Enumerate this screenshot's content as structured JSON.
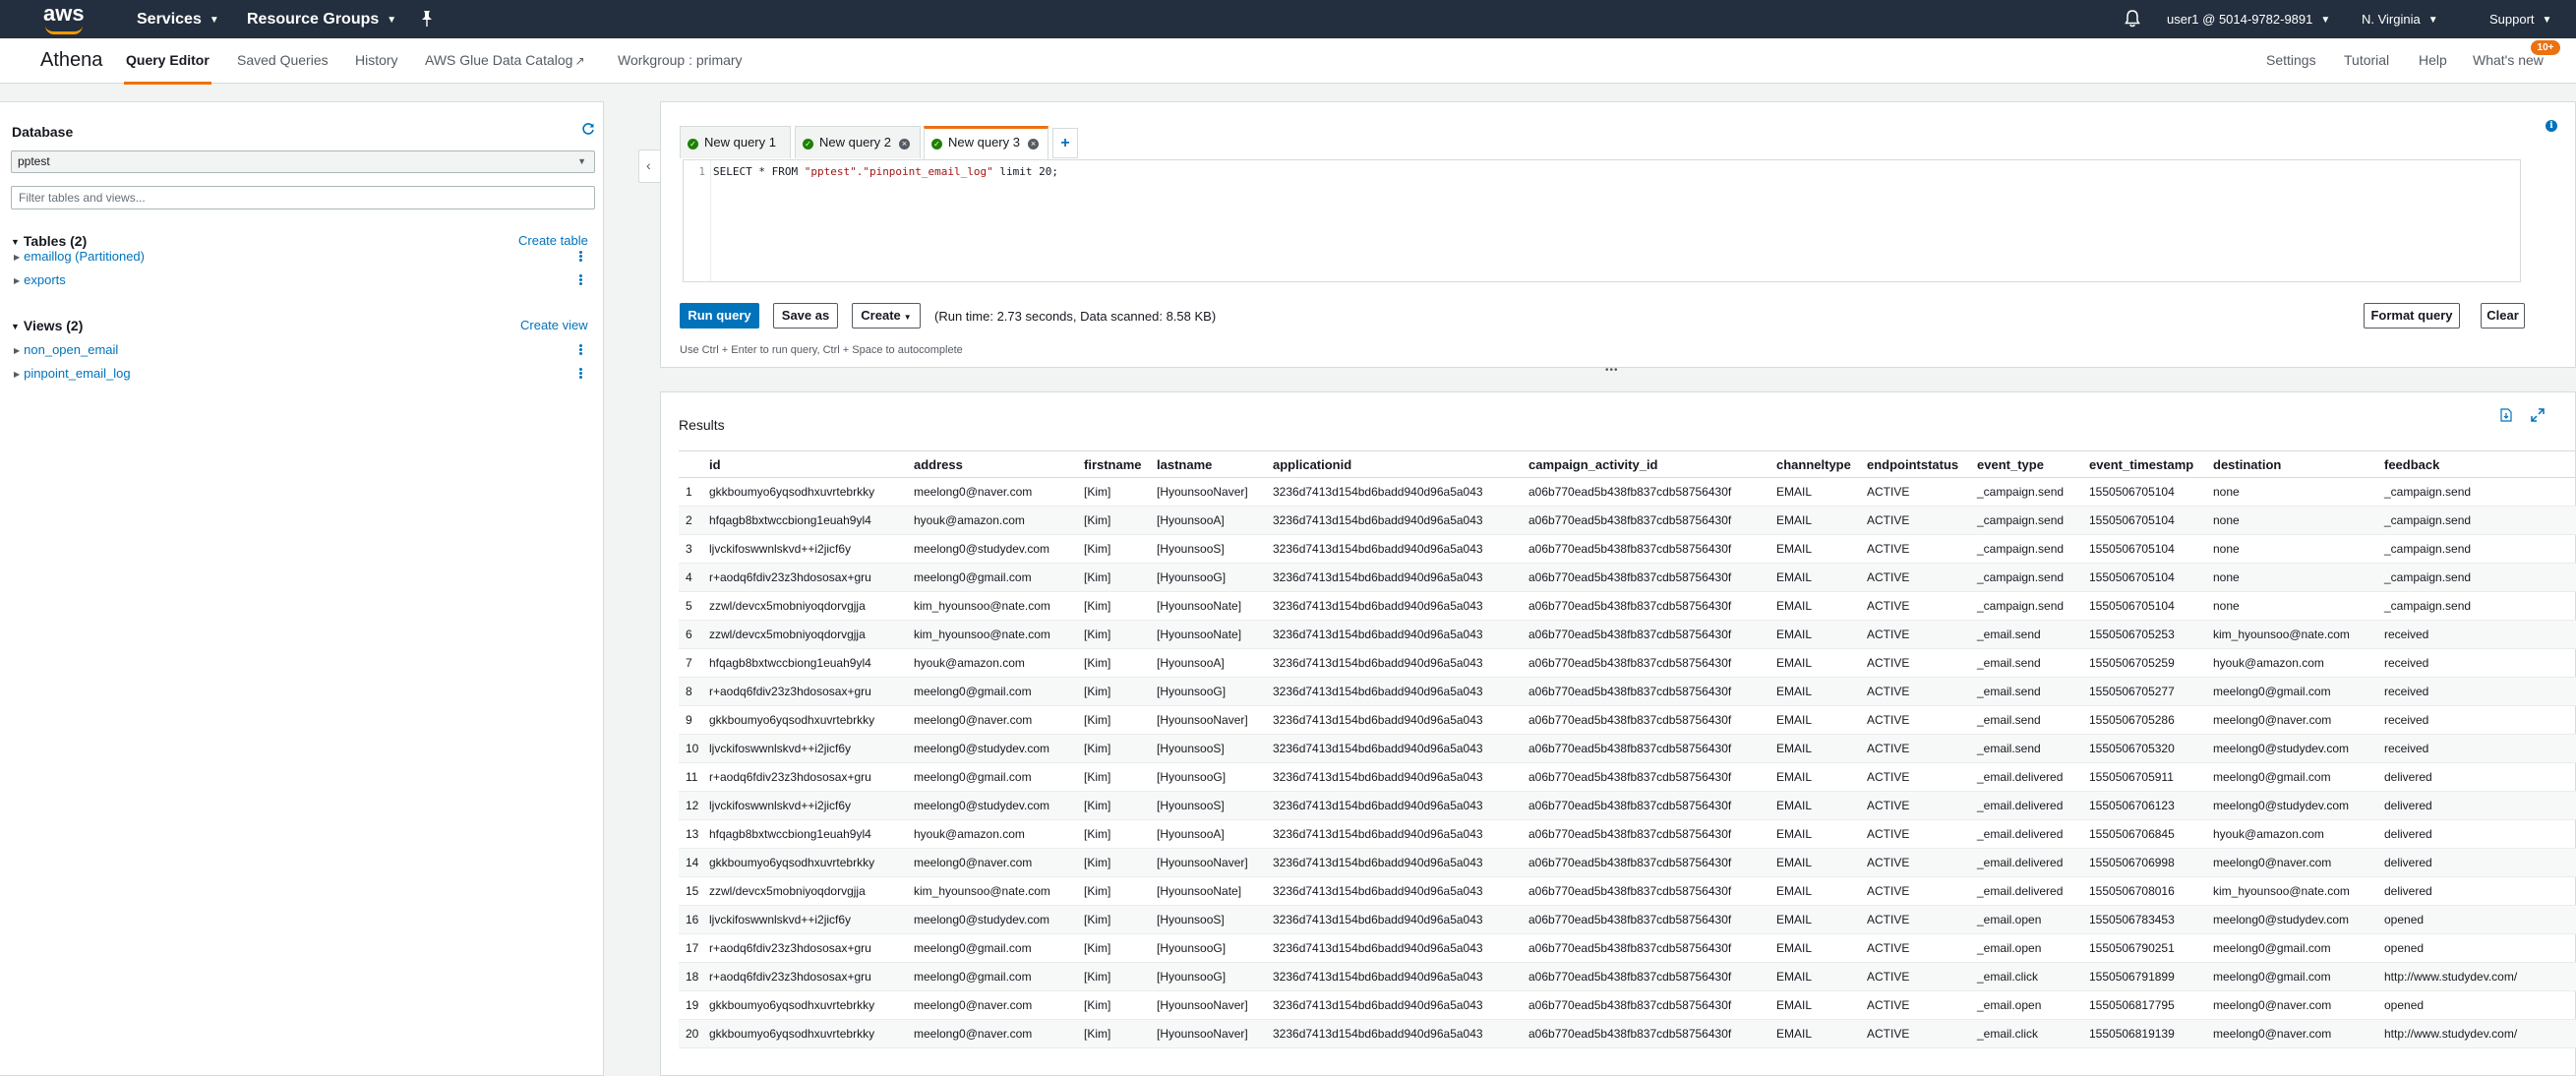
{
  "topnav": {
    "logo": "aws",
    "services": "Services",
    "resource_groups": "Resource Groups",
    "user": "user1 @ 5014-9782-9891",
    "region": "N. Virginia",
    "support": "Support"
  },
  "subnav": {
    "brand": "Athena",
    "tabs": [
      "Query Editor",
      "Saved Queries",
      "History",
      "AWS Glue Data Catalog",
      "Workgroup : primary"
    ],
    "right": [
      "Settings",
      "Tutorial",
      "Help",
      "What's new"
    ],
    "badge": "10+"
  },
  "sidebar": {
    "title": "Database",
    "selected_db": "pptest",
    "filter_placeholder": "Filter tables and views...",
    "tables_header": "Tables (2)",
    "create_table": "Create table",
    "tables": [
      "emaillog (Partitioned)",
      "exports"
    ],
    "views_header": "Views (2)",
    "create_view": "Create view",
    "views": [
      "non_open_email",
      "pinpoint_email_log"
    ]
  },
  "editor": {
    "tabs": [
      "New query 1",
      "New query 2",
      "New query 3"
    ],
    "line_number": "1",
    "sql_prefix": "SELECT * FROM ",
    "sql_string": "\"pptest\".\"pinpoint_email_log\"",
    "sql_suffix": " limit 20;",
    "run_button": "Run query",
    "save_button": "Save as",
    "create_button": "Create",
    "run_info": "(Run time: 2.73 seconds, Data scanned: 8.58 KB)",
    "format_button": "Format query",
    "clear_button": "Clear",
    "hint": "Use Ctrl + Enter to run query, Ctrl + Space to autocomplete"
  },
  "results": {
    "title": "Results",
    "columns": [
      "",
      "id",
      "address",
      "firstname",
      "lastname",
      "applicationid",
      "campaign_activity_id",
      "channeltype",
      "endpointstatus",
      "event_type",
      "event_timestamp",
      "destination",
      "feedback"
    ],
    "rows": [
      [
        "1",
        "gkkboumyo6yqsodhxuvrtebrkky",
        "meelong0@naver.com",
        "[Kim]",
        "[HyounsooNaver]",
        "3236d7413d154bd6badd940d96a5a043",
        "a06b770ead5b438fb837cdb58756430f",
        "EMAIL",
        "ACTIVE",
        "_campaign.send",
        "1550506705104",
        "none",
        "_campaign.send"
      ],
      [
        "2",
        "hfqagb8bxtwccbiong1euah9yl4",
        "hyouk@amazon.com",
        "[Kim]",
        "[HyounsooA]",
        "3236d7413d154bd6badd940d96a5a043",
        "a06b770ead5b438fb837cdb58756430f",
        "EMAIL",
        "ACTIVE",
        "_campaign.send",
        "1550506705104",
        "none",
        "_campaign.send"
      ],
      [
        "3",
        "ljvckifoswwnlskvd++i2jicf6y",
        "meelong0@studydev.com",
        "[Kim]",
        "[HyounsooS]",
        "3236d7413d154bd6badd940d96a5a043",
        "a06b770ead5b438fb837cdb58756430f",
        "EMAIL",
        "ACTIVE",
        "_campaign.send",
        "1550506705104",
        "none",
        "_campaign.send"
      ],
      [
        "4",
        "r+aodq6fdiv23z3hdososax+gru",
        "meelong0@gmail.com",
        "[Kim]",
        "[HyounsooG]",
        "3236d7413d154bd6badd940d96a5a043",
        "a06b770ead5b438fb837cdb58756430f",
        "EMAIL",
        "ACTIVE",
        "_campaign.send",
        "1550506705104",
        "none",
        "_campaign.send"
      ],
      [
        "5",
        "zzwl/devcx5mobniyoqdorvgjja",
        "kim_hyounsoo@nate.com",
        "[Kim]",
        "[HyounsooNate]",
        "3236d7413d154bd6badd940d96a5a043",
        "a06b770ead5b438fb837cdb58756430f",
        "EMAIL",
        "ACTIVE",
        "_campaign.send",
        "1550506705104",
        "none",
        "_campaign.send"
      ],
      [
        "6",
        "zzwl/devcx5mobniyoqdorvgjja",
        "kim_hyounsoo@nate.com",
        "[Kim]",
        "[HyounsooNate]",
        "3236d7413d154bd6badd940d96a5a043",
        "a06b770ead5b438fb837cdb58756430f",
        "EMAIL",
        "ACTIVE",
        "_email.send",
        "1550506705253",
        "kim_hyounsoo@nate.com",
        "received"
      ],
      [
        "7",
        "hfqagb8bxtwccbiong1euah9yl4",
        "hyouk@amazon.com",
        "[Kim]",
        "[HyounsooA]",
        "3236d7413d154bd6badd940d96a5a043",
        "a06b770ead5b438fb837cdb58756430f",
        "EMAIL",
        "ACTIVE",
        "_email.send",
        "1550506705259",
        "hyouk@amazon.com",
        "received"
      ],
      [
        "8",
        "r+aodq6fdiv23z3hdososax+gru",
        "meelong0@gmail.com",
        "[Kim]",
        "[HyounsooG]",
        "3236d7413d154bd6badd940d96a5a043",
        "a06b770ead5b438fb837cdb58756430f",
        "EMAIL",
        "ACTIVE",
        "_email.send",
        "1550506705277",
        "meelong0@gmail.com",
        "received"
      ],
      [
        "9",
        "gkkboumyo6yqsodhxuvrtebrkky",
        "meelong0@naver.com",
        "[Kim]",
        "[HyounsooNaver]",
        "3236d7413d154bd6badd940d96a5a043",
        "a06b770ead5b438fb837cdb58756430f",
        "EMAIL",
        "ACTIVE",
        "_email.send",
        "1550506705286",
        "meelong0@naver.com",
        "received"
      ],
      [
        "10",
        "ljvckifoswwnlskvd++i2jicf6y",
        "meelong0@studydev.com",
        "[Kim]",
        "[HyounsooS]",
        "3236d7413d154bd6badd940d96a5a043",
        "a06b770ead5b438fb837cdb58756430f",
        "EMAIL",
        "ACTIVE",
        "_email.send",
        "1550506705320",
        "meelong0@studydev.com",
        "received"
      ],
      [
        "11",
        "r+aodq6fdiv23z3hdososax+gru",
        "meelong0@gmail.com",
        "[Kim]",
        "[HyounsooG]",
        "3236d7413d154bd6badd940d96a5a043",
        "a06b770ead5b438fb837cdb58756430f",
        "EMAIL",
        "ACTIVE",
        "_email.delivered",
        "1550506705911",
        "meelong0@gmail.com",
        "delivered"
      ],
      [
        "12",
        "ljvckifoswwnlskvd++i2jicf6y",
        "meelong0@studydev.com",
        "[Kim]",
        "[HyounsooS]",
        "3236d7413d154bd6badd940d96a5a043",
        "a06b770ead5b438fb837cdb58756430f",
        "EMAIL",
        "ACTIVE",
        "_email.delivered",
        "1550506706123",
        "meelong0@studydev.com",
        "delivered"
      ],
      [
        "13",
        "hfqagb8bxtwccbiong1euah9yl4",
        "hyouk@amazon.com",
        "[Kim]",
        "[HyounsooA]",
        "3236d7413d154bd6badd940d96a5a043",
        "a06b770ead5b438fb837cdb58756430f",
        "EMAIL",
        "ACTIVE",
        "_email.delivered",
        "1550506706845",
        "hyouk@amazon.com",
        "delivered"
      ],
      [
        "14",
        "gkkboumyo6yqsodhxuvrtebrkky",
        "meelong0@naver.com",
        "[Kim]",
        "[HyounsooNaver]",
        "3236d7413d154bd6badd940d96a5a043",
        "a06b770ead5b438fb837cdb58756430f",
        "EMAIL",
        "ACTIVE",
        "_email.delivered",
        "1550506706998",
        "meelong0@naver.com",
        "delivered"
      ],
      [
        "15",
        "zzwl/devcx5mobniyoqdorvgjja",
        "kim_hyounsoo@nate.com",
        "[Kim]",
        "[HyounsooNate]",
        "3236d7413d154bd6badd940d96a5a043",
        "a06b770ead5b438fb837cdb58756430f",
        "EMAIL",
        "ACTIVE",
        "_email.delivered",
        "1550506708016",
        "kim_hyounsoo@nate.com",
        "delivered"
      ],
      [
        "16",
        "ljvckifoswwnlskvd++i2jicf6y",
        "meelong0@studydev.com",
        "[Kim]",
        "[HyounsooS]",
        "3236d7413d154bd6badd940d96a5a043",
        "a06b770ead5b438fb837cdb58756430f",
        "EMAIL",
        "ACTIVE",
        "_email.open",
        "1550506783453",
        "meelong0@studydev.com",
        "opened"
      ],
      [
        "17",
        "r+aodq6fdiv23z3hdososax+gru",
        "meelong0@gmail.com",
        "[Kim]",
        "[HyounsooG]",
        "3236d7413d154bd6badd940d96a5a043",
        "a06b770ead5b438fb837cdb58756430f",
        "EMAIL",
        "ACTIVE",
        "_email.open",
        "1550506790251",
        "meelong0@gmail.com",
        "opened"
      ],
      [
        "18",
        "r+aodq6fdiv23z3hdososax+gru",
        "meelong0@gmail.com",
        "[Kim]",
        "[HyounsooG]",
        "3236d7413d154bd6badd940d96a5a043",
        "a06b770ead5b438fb837cdb58756430f",
        "EMAIL",
        "ACTIVE",
        "_email.click",
        "1550506791899",
        "meelong0@gmail.com",
        "http://www.studydev.com/"
      ],
      [
        "19",
        "gkkboumyo6yqsodhxuvrtebrkky",
        "meelong0@naver.com",
        "[Kim]",
        "[HyounsooNaver]",
        "3236d7413d154bd6badd940d96a5a043",
        "a06b770ead5b438fb837cdb58756430f",
        "EMAIL",
        "ACTIVE",
        "_email.open",
        "1550506817795",
        "meelong0@naver.com",
        "opened"
      ],
      [
        "20",
        "gkkboumyo6yqsodhxuvrtebrkky",
        "meelong0@naver.com",
        "[Kim]",
        "[HyounsooNaver]",
        "3236d7413d154bd6badd940d96a5a043",
        "a06b770ead5b438fb837cdb58756430f",
        "EMAIL",
        "ACTIVE",
        "_email.click",
        "1550506819139",
        "meelong0@naver.com",
        "http://www.studydev.com/"
      ]
    ]
  },
  "colors": {
    "nav_bg": "#232f3e",
    "accent": "#ec7211",
    "link": "#0073bb",
    "success": "#1d8102"
  }
}
